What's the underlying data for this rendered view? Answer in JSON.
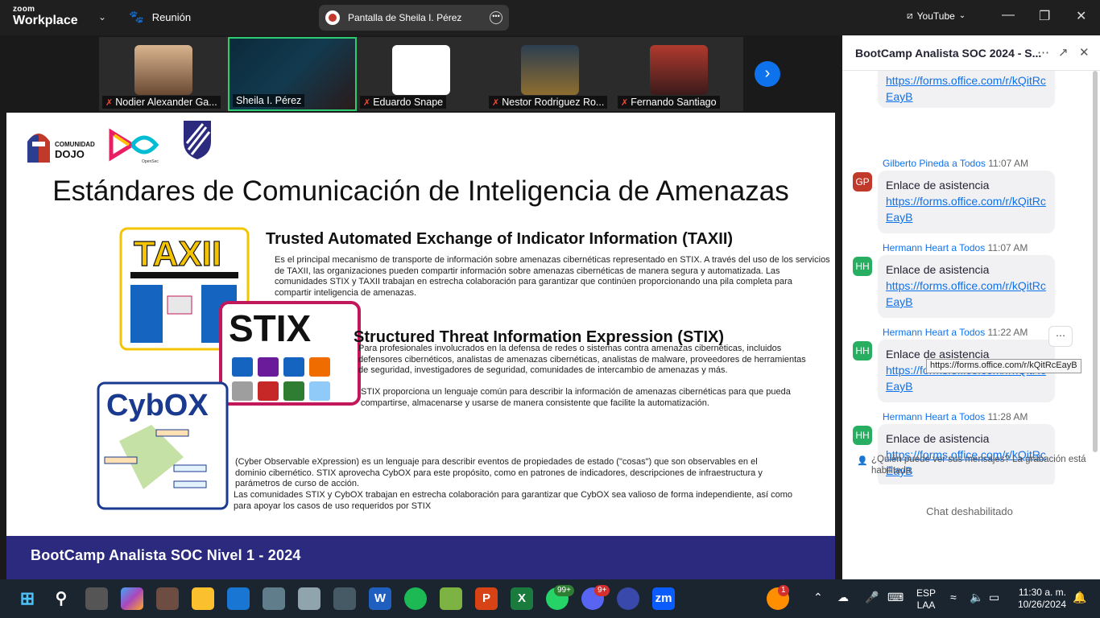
{
  "titlebar": {
    "brand_small": "zoom",
    "brand_big": "Workplace",
    "meeting_label": "Reunión",
    "share_label": "Pantalla de Sheila I. Pérez",
    "youtube_label": "YouTube"
  },
  "participants": [
    {
      "name": "Nodier Alexander Ga..."
    },
    {
      "name": "Sheila I. Pérez"
    },
    {
      "name": "Eduardo Snape"
    },
    {
      "name": "Nestor Rodriguez Ro..."
    },
    {
      "name": "Fernando Santiago"
    }
  ],
  "slide": {
    "logo_dojo_top": "COMUNIDAD",
    "logo_dojo_bottom": "DOJO",
    "logo_open": "OpenSec",
    "title": "Estándares de Comunicación de Inteligencia de Amenazas",
    "taxii_heading": "Trusted Automated Exchange of Indicator Information (TAXII)",
    "taxii_p": "Es el principal mecanismo de transporte de información sobre amenazas cibernéticas representado en STIX. A través del uso de los servicios de TAXII, las organizaciones pueden compartir información sobre amenazas cibernéticas de manera segura y automatizada. Las comunidades STIX y TAXII trabajan en estrecha colaboración para garantizar que continúen proporcionando una pila completa para compartir inteligencia de amenazas.",
    "stix_heading": "Structured Threat Information Expression (STIX)",
    "stix_p1": "Para profesionales involucrados en la defensa de redes o sistemas contra amenazas cibernéticas, incluidos defensores cibernéticos, analistas de amenazas cibernéticas, analistas de malware, proveedores de herramientas de seguridad, investigadores de seguridad, comunidades de intercambio de amenazas y más.",
    "stix_p2": "STIX proporciona un lenguaje común para describir la información de amenazas cibernéticas para que pueda compartirse, almacenarse y usarse de manera consistente que facilite la automatización.",
    "cybox_p1": "(Cyber Observable eXpression) es un lenguaje para describir eventos de propiedades de estado (\"cosas\") que son observables en el dominio cibernético. STIX aprovecha CybOX para este propósito, como en patrones de indicadores, descripciones de infraestructura y parámetros de curso de acción.",
    "cybox_p2": "Las comunidades STIX y CybOX trabajan en estrecha colaboración para garantizar que CybOX sea valioso de forma independiente, así como para apoyar los casos de uso requeridos por STIX",
    "img_taxii": "TAXII",
    "img_stix": "STIX",
    "img_cybox": "CybOX",
    "footer": "BootCamp Analista SOC Nivel 1 - 2024"
  },
  "chat": {
    "title": "BootCamp Analista SOC 2024 - S...",
    "first_link": "https://forms.office.com/r/kQitRcEayB",
    "messages": [
      {
        "sender": "Gilberto Pineda",
        "to": "a Todos",
        "time": "11:07 AM",
        "initials": "GP",
        "color": "#c0392b",
        "text": "Enlace de asistencia",
        "link": "https://forms.office.com/r/kQitRcEayB"
      },
      {
        "sender": "Hermann Heart",
        "to": "a Todos",
        "time": "11:07 AM",
        "initials": "HH",
        "color": "#27ae60",
        "text": "Enlace de asistencia",
        "link": "https://forms.office.com/r/kQitRcEayB"
      },
      {
        "sender": "Hermann Heart",
        "to": "a Todos",
        "time": "11:22 AM",
        "initials": "HH",
        "color": "#27ae60",
        "text": "Enlace de asistencia",
        "link": "https://forms.office.com/r/kQitRcEayB"
      },
      {
        "sender": "Hermann Heart",
        "to": "a Todos",
        "time": "11:28 AM",
        "initials": "HH",
        "color": "#27ae60",
        "text": "Enlace de asistencia",
        "link": "https://forms.office.com/r/kQitRcEayB"
      }
    ],
    "tooltip": "https://forms.office.com/r/kQitRcEayB",
    "privacy": "¿Quién puede ver sus mensajes? La grabación está habilitada",
    "disabled": "Chat deshabilitado"
  },
  "taskbar": {
    "lang_top": "ESP",
    "lang_bottom": "LAA",
    "time": "11:30 a. m.",
    "date": "10/26/2024",
    "badge_whatsapp": "99+",
    "badge_discord": "9+",
    "badge_weather": "1"
  }
}
